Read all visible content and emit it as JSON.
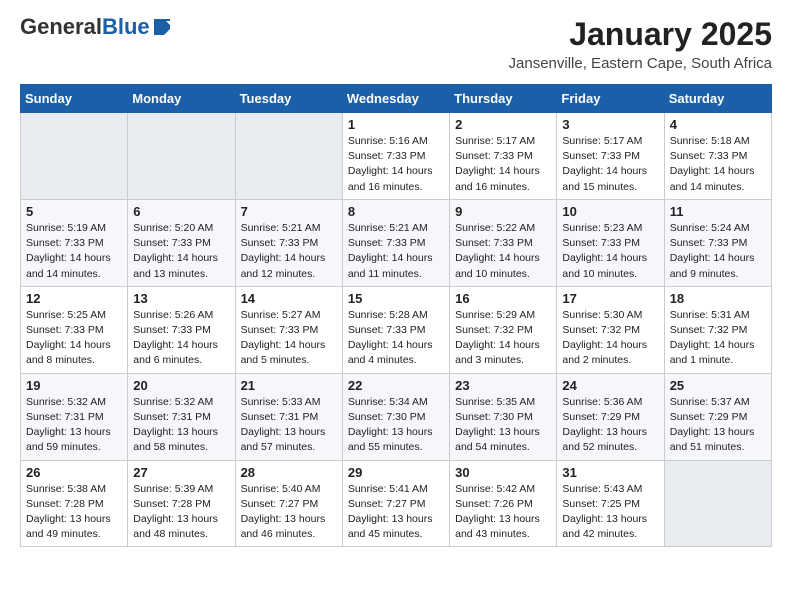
{
  "logo": {
    "general": "General",
    "blue": "Blue"
  },
  "header": {
    "month": "January 2025",
    "location": "Jansenville, Eastern Cape, South Africa"
  },
  "weekdays": [
    "Sunday",
    "Monday",
    "Tuesday",
    "Wednesday",
    "Thursday",
    "Friday",
    "Saturday"
  ],
  "weeks": [
    [
      {
        "day": "",
        "info": ""
      },
      {
        "day": "",
        "info": ""
      },
      {
        "day": "",
        "info": ""
      },
      {
        "day": "1",
        "info": "Sunrise: 5:16 AM\nSunset: 7:33 PM\nDaylight: 14 hours and 16 minutes."
      },
      {
        "day": "2",
        "info": "Sunrise: 5:17 AM\nSunset: 7:33 PM\nDaylight: 14 hours and 16 minutes."
      },
      {
        "day": "3",
        "info": "Sunrise: 5:17 AM\nSunset: 7:33 PM\nDaylight: 14 hours and 15 minutes."
      },
      {
        "day": "4",
        "info": "Sunrise: 5:18 AM\nSunset: 7:33 PM\nDaylight: 14 hours and 14 minutes."
      }
    ],
    [
      {
        "day": "5",
        "info": "Sunrise: 5:19 AM\nSunset: 7:33 PM\nDaylight: 14 hours and 14 minutes."
      },
      {
        "day": "6",
        "info": "Sunrise: 5:20 AM\nSunset: 7:33 PM\nDaylight: 14 hours and 13 minutes."
      },
      {
        "day": "7",
        "info": "Sunrise: 5:21 AM\nSunset: 7:33 PM\nDaylight: 14 hours and 12 minutes."
      },
      {
        "day": "8",
        "info": "Sunrise: 5:21 AM\nSunset: 7:33 PM\nDaylight: 14 hours and 11 minutes."
      },
      {
        "day": "9",
        "info": "Sunrise: 5:22 AM\nSunset: 7:33 PM\nDaylight: 14 hours and 10 minutes."
      },
      {
        "day": "10",
        "info": "Sunrise: 5:23 AM\nSunset: 7:33 PM\nDaylight: 14 hours and 10 minutes."
      },
      {
        "day": "11",
        "info": "Sunrise: 5:24 AM\nSunset: 7:33 PM\nDaylight: 14 hours and 9 minutes."
      }
    ],
    [
      {
        "day": "12",
        "info": "Sunrise: 5:25 AM\nSunset: 7:33 PM\nDaylight: 14 hours and 8 minutes."
      },
      {
        "day": "13",
        "info": "Sunrise: 5:26 AM\nSunset: 7:33 PM\nDaylight: 14 hours and 6 minutes."
      },
      {
        "day": "14",
        "info": "Sunrise: 5:27 AM\nSunset: 7:33 PM\nDaylight: 14 hours and 5 minutes."
      },
      {
        "day": "15",
        "info": "Sunrise: 5:28 AM\nSunset: 7:33 PM\nDaylight: 14 hours and 4 minutes."
      },
      {
        "day": "16",
        "info": "Sunrise: 5:29 AM\nSunset: 7:32 PM\nDaylight: 14 hours and 3 minutes."
      },
      {
        "day": "17",
        "info": "Sunrise: 5:30 AM\nSunset: 7:32 PM\nDaylight: 14 hours and 2 minutes."
      },
      {
        "day": "18",
        "info": "Sunrise: 5:31 AM\nSunset: 7:32 PM\nDaylight: 14 hours and 1 minute."
      }
    ],
    [
      {
        "day": "19",
        "info": "Sunrise: 5:32 AM\nSunset: 7:31 PM\nDaylight: 13 hours and 59 minutes."
      },
      {
        "day": "20",
        "info": "Sunrise: 5:32 AM\nSunset: 7:31 PM\nDaylight: 13 hours and 58 minutes."
      },
      {
        "day": "21",
        "info": "Sunrise: 5:33 AM\nSunset: 7:31 PM\nDaylight: 13 hours and 57 minutes."
      },
      {
        "day": "22",
        "info": "Sunrise: 5:34 AM\nSunset: 7:30 PM\nDaylight: 13 hours and 55 minutes."
      },
      {
        "day": "23",
        "info": "Sunrise: 5:35 AM\nSunset: 7:30 PM\nDaylight: 13 hours and 54 minutes."
      },
      {
        "day": "24",
        "info": "Sunrise: 5:36 AM\nSunset: 7:29 PM\nDaylight: 13 hours and 52 minutes."
      },
      {
        "day": "25",
        "info": "Sunrise: 5:37 AM\nSunset: 7:29 PM\nDaylight: 13 hours and 51 minutes."
      }
    ],
    [
      {
        "day": "26",
        "info": "Sunrise: 5:38 AM\nSunset: 7:28 PM\nDaylight: 13 hours and 49 minutes."
      },
      {
        "day": "27",
        "info": "Sunrise: 5:39 AM\nSunset: 7:28 PM\nDaylight: 13 hours and 48 minutes."
      },
      {
        "day": "28",
        "info": "Sunrise: 5:40 AM\nSunset: 7:27 PM\nDaylight: 13 hours and 46 minutes."
      },
      {
        "day": "29",
        "info": "Sunrise: 5:41 AM\nSunset: 7:27 PM\nDaylight: 13 hours and 45 minutes."
      },
      {
        "day": "30",
        "info": "Sunrise: 5:42 AM\nSunset: 7:26 PM\nDaylight: 13 hours and 43 minutes."
      },
      {
        "day": "31",
        "info": "Sunrise: 5:43 AM\nSunset: 7:25 PM\nDaylight: 13 hours and 42 minutes."
      },
      {
        "day": "",
        "info": ""
      }
    ]
  ]
}
